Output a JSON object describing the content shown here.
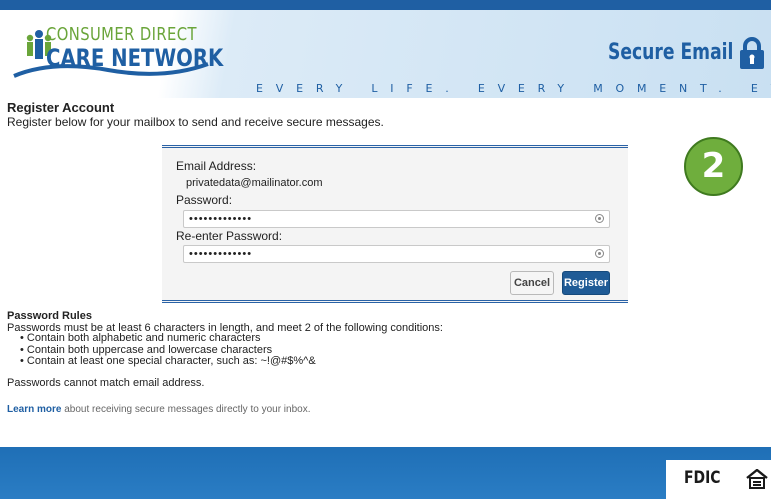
{
  "header": {
    "logo_line1": "CONSUMER DIRECT",
    "logo_line2": "CARE NETWORK",
    "tagline": "EVERY LIFE. EVERY MOMENT. EVERY DAY.",
    "title": "Secure Email",
    "lock_icon": "lock-icon",
    "brand_color": "#1f5fa3",
    "accent_color": "#6aa53a"
  },
  "page": {
    "title": "Register Account",
    "subtitle": "Register below for your mailbox to send and receive secure messages."
  },
  "form": {
    "email_label": "Email Address:",
    "email_value": "privatedata@mailinator.com",
    "password_label": "Password:",
    "password_value": "•••••••••••••",
    "reenter_label": "Re-enter Password:",
    "reenter_value": "•••••••••••••",
    "cancel_label": "Cancel",
    "register_label": "Register"
  },
  "step_badge": "2",
  "rules": {
    "title": "Password Rules",
    "intro": "Passwords must be at least 6 characters in length, and meet 2 of the following conditions:",
    "items": [
      "Contain both alphabetic and numeric characters",
      "Contain both uppercase and lowercase characters",
      "Contain at least one special character, such as: ~!@#$%^&"
    ],
    "footer": "Passwords cannot match email address."
  },
  "learn_more": {
    "link": "Learn more",
    "text": " about receiving secure messages directly to your inbox."
  },
  "footer": {
    "fdic_label": "FDIC"
  }
}
